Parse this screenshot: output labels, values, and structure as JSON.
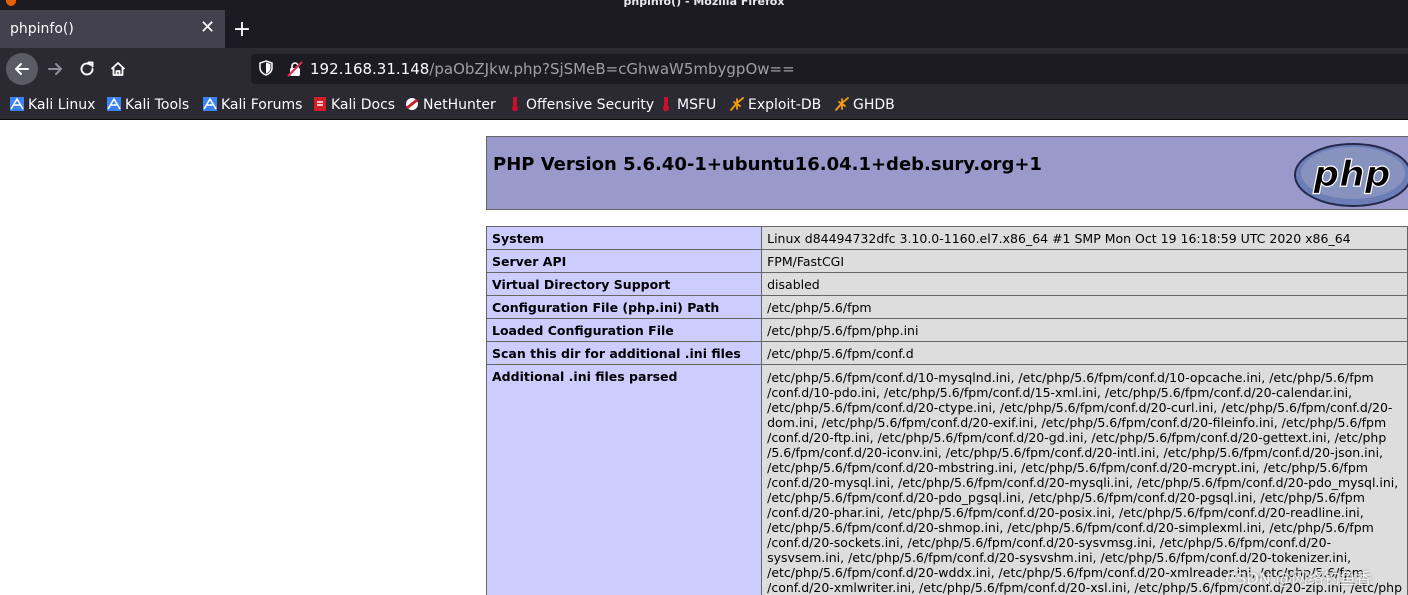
{
  "window": {
    "title": "phpinfo() - Mozilla Firefox"
  },
  "tab": {
    "label": "phpinfo()",
    "close_symbol": "✕"
  },
  "toolbar": {
    "new_tab_symbol": "+"
  },
  "urlbar": {
    "host": "192.168.31.148",
    "path": "/paObZJkw.php?SjSMeB=cGhwaW5mbygpOw=="
  },
  "bookmarks": [
    {
      "label": "Kali Linux",
      "icon": "kali-dragon-icon"
    },
    {
      "label": "Kali Tools",
      "icon": "kali-dragon-icon"
    },
    {
      "label": "Kali Forums",
      "icon": "kali-dragon-icon"
    },
    {
      "label": "Kali Docs",
      "icon": "kali-docs-icon"
    },
    {
      "label": "NetHunter",
      "icon": "nethunter-icon"
    },
    {
      "label": "Offensive Security",
      "icon": "offsec-icon"
    },
    {
      "label": "MSFU",
      "icon": "offsec-icon"
    },
    {
      "label": "Exploit-DB",
      "icon": "exploitdb-icon"
    },
    {
      "label": "GHDB",
      "icon": "exploitdb-icon"
    }
  ],
  "php": {
    "version_heading": "PHP Version 5.6.40-1+ubuntu16.04.1+deb.sury.org+1",
    "logo_text": "php",
    "rows": [
      {
        "key": "System",
        "value": "Linux d84494732dfc 3.10.0-1160.el7.x86_64 #1 SMP Mon Oct 19 16:18:59 UTC 2020 x86_64"
      },
      {
        "key": "Server API",
        "value": "FPM/FastCGI"
      },
      {
        "key": "Virtual Directory Support",
        "value": "disabled"
      },
      {
        "key": "Configuration File (php.ini) Path",
        "value": "/etc/php/5.6/fpm"
      },
      {
        "key": "Loaded Configuration File",
        "value": "/etc/php/5.6/fpm/php.ini"
      },
      {
        "key": "Scan this dir for additional .ini files",
        "value": "/etc/php/5.6/fpm/conf.d"
      }
    ],
    "ini_parsed_key": "Additional .ini files parsed",
    "ini_parsed_lines": [
      "/etc/php/5.6/fpm/conf.d/10-mysqlnd.ini, /etc/php/5.6/fpm/conf.d/10-opcache.ini, /etc/php/5.6/fpm",
      "/conf.d/10-pdo.ini, /etc/php/5.6/fpm/conf.d/15-xml.ini, /etc/php/5.6/fpm/conf.d/20-calendar.ini,",
      "/etc/php/5.6/fpm/conf.d/20-ctype.ini, /etc/php/5.6/fpm/conf.d/20-curl.ini, /etc/php/5.6/fpm/conf.d/20-",
      "dom.ini, /etc/php/5.6/fpm/conf.d/20-exif.ini, /etc/php/5.6/fpm/conf.d/20-fileinfo.ini, /etc/php/5.6/fpm",
      "/conf.d/20-ftp.ini, /etc/php/5.6/fpm/conf.d/20-gd.ini, /etc/php/5.6/fpm/conf.d/20-gettext.ini, /etc/php",
      "/5.6/fpm/conf.d/20-iconv.ini, /etc/php/5.6/fpm/conf.d/20-intl.ini, /etc/php/5.6/fpm/conf.d/20-json.ini,",
      "/etc/php/5.6/fpm/conf.d/20-mbstring.ini, /etc/php/5.6/fpm/conf.d/20-mcrypt.ini, /etc/php/5.6/fpm",
      "/conf.d/20-mysql.ini, /etc/php/5.6/fpm/conf.d/20-mysqli.ini, /etc/php/5.6/fpm/conf.d/20-pdo_mysql.ini,",
      "/etc/php/5.6/fpm/conf.d/20-pdo_pgsql.ini, /etc/php/5.6/fpm/conf.d/20-pgsql.ini, /etc/php/5.6/fpm",
      "/conf.d/20-phar.ini, /etc/php/5.6/fpm/conf.d/20-posix.ini, /etc/php/5.6/fpm/conf.d/20-readline.ini,",
      "/etc/php/5.6/fpm/conf.d/20-shmop.ini, /etc/php/5.6/fpm/conf.d/20-simplexml.ini, /etc/php/5.6/fpm",
      "/conf.d/20-sockets.ini, /etc/php/5.6/fpm/conf.d/20-sysvmsg.ini, /etc/php/5.6/fpm/conf.d/20-",
      "sysvsem.ini, /etc/php/5.6/fpm/conf.d/20-sysvshm.ini, /etc/php/5.6/fpm/conf.d/20-tokenizer.ini,",
      "/etc/php/5.6/fpm/conf.d/20-wddx.ini, /etc/php/5.6/fpm/conf.d/20-xmlreader.ini, /etc/php/5.6/fpm",
      "/conf.d/20-xmlwriter.ini, /etc/php/5.6/fpm/conf.d/20-xsl.ini, /etc/php/5.6/fpm/conf.d/20-zip.ini, /etc/php"
    ]
  },
  "watermark": "CSDN @网络钓鱼香"
}
